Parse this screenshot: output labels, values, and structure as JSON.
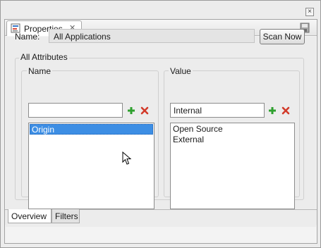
{
  "view_tab": {
    "title": "Properties",
    "icon": "properties-icon"
  },
  "name_row": {
    "label": "Name:",
    "value": "All Applications",
    "scan_button": "Scan Now"
  },
  "attributes": {
    "title": "All Attributes",
    "name_panel": {
      "label": "Name",
      "input_value": "",
      "items": [
        "Origin"
      ],
      "selected_index": 0
    },
    "value_panel": {
      "label": "Value",
      "input_value": "Internal",
      "items": [
        "Open Source",
        "External"
      ]
    }
  },
  "bottom_tabs": [
    {
      "label": "Overview",
      "active": true
    },
    {
      "label": "Filters",
      "active": false
    }
  ],
  "colors": {
    "selection": "#3d8ee4",
    "add_icon": "#2ea02e",
    "remove_icon": "#d23a2a"
  }
}
